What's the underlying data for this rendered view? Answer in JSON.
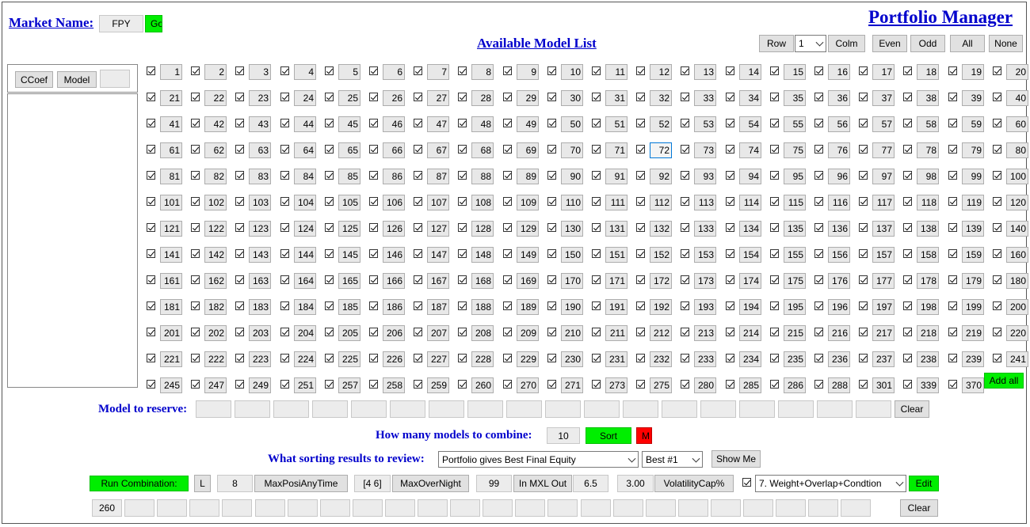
{
  "header": {
    "market_label": "Market Name:",
    "market_value": "FPY",
    "go_label": "Go",
    "app_title": "Portfolio Manager",
    "list_title": "Available Model List"
  },
  "toolbar": {
    "row_label": "Row",
    "row_select": "1",
    "colm_label": "Colm",
    "even_label": "Even",
    "odd_label": "Odd",
    "all_label": "All",
    "none_label": "None"
  },
  "left_panel": {
    "ccoef_label": "CCoef",
    "model_label": "Model",
    "model_value": ""
  },
  "model_grid": {
    "rows": [
      [
        "1",
        "2",
        "3",
        "4",
        "5",
        "6",
        "7",
        "8",
        "9",
        "10",
        "11",
        "12",
        "13",
        "14",
        "15",
        "16",
        "17",
        "18",
        "19",
        "20"
      ],
      [
        "21",
        "22",
        "23",
        "24",
        "25",
        "26",
        "27",
        "28",
        "29",
        "30",
        "31",
        "32",
        "33",
        "34",
        "35",
        "36",
        "37",
        "38",
        "39",
        "40"
      ],
      [
        "41",
        "42",
        "43",
        "44",
        "45",
        "46",
        "47",
        "48",
        "49",
        "50",
        "51",
        "52",
        "53",
        "54",
        "55",
        "56",
        "57",
        "58",
        "59",
        "60"
      ],
      [
        "61",
        "62",
        "63",
        "64",
        "65",
        "66",
        "67",
        "68",
        "69",
        "70",
        "71",
        "72",
        "73",
        "74",
        "75",
        "76",
        "77",
        "78",
        "79",
        "80"
      ],
      [
        "81",
        "82",
        "83",
        "84",
        "85",
        "86",
        "87",
        "88",
        "89",
        "90",
        "91",
        "92",
        "93",
        "94",
        "95",
        "96",
        "97",
        "98",
        "99",
        "100"
      ],
      [
        "101",
        "102",
        "103",
        "104",
        "105",
        "106",
        "107",
        "108",
        "109",
        "110",
        "111",
        "112",
        "113",
        "114",
        "115",
        "116",
        "117",
        "118",
        "119",
        "120"
      ],
      [
        "121",
        "122",
        "123",
        "124",
        "125",
        "126",
        "127",
        "128",
        "129",
        "130",
        "131",
        "132",
        "133",
        "134",
        "135",
        "136",
        "137",
        "138",
        "139",
        "140"
      ],
      [
        "141",
        "142",
        "143",
        "144",
        "145",
        "146",
        "147",
        "148",
        "149",
        "150",
        "151",
        "152",
        "153",
        "154",
        "155",
        "156",
        "157",
        "158",
        "159",
        "160"
      ],
      [
        "161",
        "162",
        "163",
        "164",
        "165",
        "166",
        "167",
        "168",
        "169",
        "170",
        "171",
        "172",
        "173",
        "174",
        "175",
        "176",
        "177",
        "178",
        "179",
        "180"
      ],
      [
        "181",
        "182",
        "183",
        "184",
        "185",
        "186",
        "187",
        "188",
        "189",
        "190",
        "191",
        "192",
        "193",
        "194",
        "195",
        "196",
        "197",
        "198",
        "199",
        "200"
      ],
      [
        "201",
        "202",
        "203",
        "204",
        "205",
        "206",
        "207",
        "208",
        "209",
        "210",
        "211",
        "212",
        "213",
        "214",
        "215",
        "216",
        "217",
        "218",
        "219",
        "220"
      ],
      [
        "221",
        "222",
        "223",
        "224",
        "225",
        "226",
        "227",
        "228",
        "229",
        "230",
        "231",
        "232",
        "233",
        "234",
        "235",
        "236",
        "237",
        "238",
        "239",
        "241"
      ],
      [
        "245",
        "247",
        "249",
        "251",
        "257",
        "258",
        "259",
        "260",
        "270",
        "271",
        "273",
        "275",
        "280",
        "285",
        "286",
        "288",
        "301",
        "339",
        "370"
      ]
    ],
    "focused": "72",
    "add_all_label": "Add all"
  },
  "reserve": {
    "label": "Model to reserve:",
    "values": [
      "",
      "",
      "",
      "",
      "",
      "",
      "",
      "",
      "",
      "",
      "",
      "",
      "",
      "",
      "",
      "",
      "",
      ""
    ],
    "clear_label": "Clear"
  },
  "combine": {
    "label": "How many models to combine:",
    "value": "10",
    "sort_label": "Sort",
    "m_label": "M"
  },
  "review": {
    "label": "What sorting results to review:",
    "sort_select": "Portfolio gives Best Final Equity",
    "best_select": "Best #1",
    "show_label": "Show Me"
  },
  "run_row": {
    "run_label": "Run Combination:",
    "l_label": "L",
    "maxposi_value": "8",
    "maxposi_label": "MaxPosiAnyTime",
    "overnight_value": "[4 6]",
    "overnight_label": "MaxOverNight",
    "mxl_value": "99",
    "mxl_label": "In MXL Out",
    "mxl_out_value": "6.5",
    "vol_value": "3.00",
    "vol_label": "VolatilityCap%",
    "weight_select": "7. Weight+Overlap+Condtion",
    "edit_label": "Edit"
  },
  "result_row": {
    "values": [
      "260",
      "",
      "",
      "",
      "",
      "",
      "",
      "",
      "",
      "",
      "",
      "",
      "",
      "",
      "",
      "",
      "",
      "",
      "",
      "",
      "",
      "",
      "",
      ""
    ],
    "clear_label": "Clear"
  },
  "colors": {
    "accent_green": "#00ee00",
    "alert_red": "#ff0000",
    "label_blue": "#0000cc"
  }
}
